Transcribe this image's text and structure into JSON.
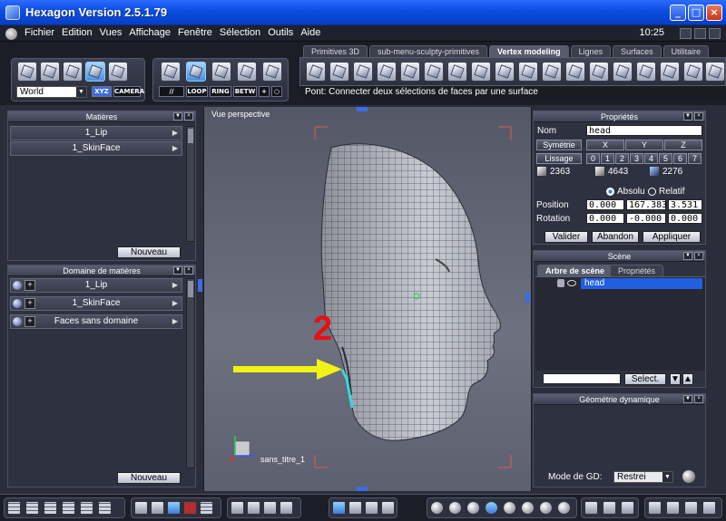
{
  "window": {
    "title": "Hexagon Version 2.5.1.79",
    "clock": "10:25"
  },
  "menu": [
    "Fichier",
    "Edition",
    "Vues",
    "Affichage",
    "Fenêtre",
    "Sélection",
    "Outils",
    "Aide"
  ],
  "toolbar": {
    "space_select": "World",
    "xyz_label": "XYZ",
    "camera_label": "CAMERA",
    "loop_label": "LOOP",
    "ring_label": "RING",
    "betw_label": "BETW"
  },
  "tabs": [
    {
      "label": "Primitives 3D",
      "active": false
    },
    {
      "label": "sub-menu-sculpty-primitives",
      "active": false
    },
    {
      "label": "Vertex modeling",
      "active": true
    },
    {
      "label": "Lignes",
      "active": false
    },
    {
      "label": "Surfaces",
      "active": false
    },
    {
      "label": "Utilitaire",
      "active": false
    }
  ],
  "status_text": "Pont: Connecter deux sélections de faces par une surface",
  "materials_panel": {
    "title": "Matières",
    "items": [
      "1_Lip",
      "1_SkinFace"
    ],
    "new_button": "Nouveau"
  },
  "material_domain_panel": {
    "title": "Domaine de matières",
    "items": [
      "1_Lip",
      "1_SkinFace",
      "Faces sans domaine"
    ],
    "new_button": "Nouveau"
  },
  "viewport": {
    "label": "Vue perspective",
    "file_name": "sans_titre_1",
    "annotation_number": "2",
    "arrow_color": "#f2f214",
    "selection_color": "#36d8e0"
  },
  "properties_panel": {
    "title": "Propriétés",
    "name_label": "Nom",
    "name_value": "head",
    "symmetry_button": "Symétrie",
    "axes": [
      "X",
      "Y",
      "Z"
    ],
    "smoothing_button": "Lissage",
    "smoothing_levels": [
      "0",
      "1",
      "2",
      "3",
      "4",
      "5",
      "6",
      "7"
    ],
    "stats": [
      "2363",
      "4643",
      "2276"
    ],
    "absolute_label": "Absolu",
    "relative_label": "Relatif",
    "position_label": "Position",
    "position": [
      "0.000",
      "167.383",
      "3.531"
    ],
    "rotation_label": "Rotation",
    "rotation": [
      "0.000",
      "-0.000",
      "0.000"
    ],
    "buttons": [
      "Valider",
      "Abandon",
      "Appliquer"
    ]
  },
  "scene_panel": {
    "title": "Scène",
    "tabs": [
      "Arbre de scène",
      "Propriétés"
    ],
    "item": "head",
    "select_button": "Select."
  },
  "dynamic_geometry_panel": {
    "title": "Géométrie dynamique",
    "mode_label": "Mode de GD:",
    "mode_value": "Restrei"
  }
}
